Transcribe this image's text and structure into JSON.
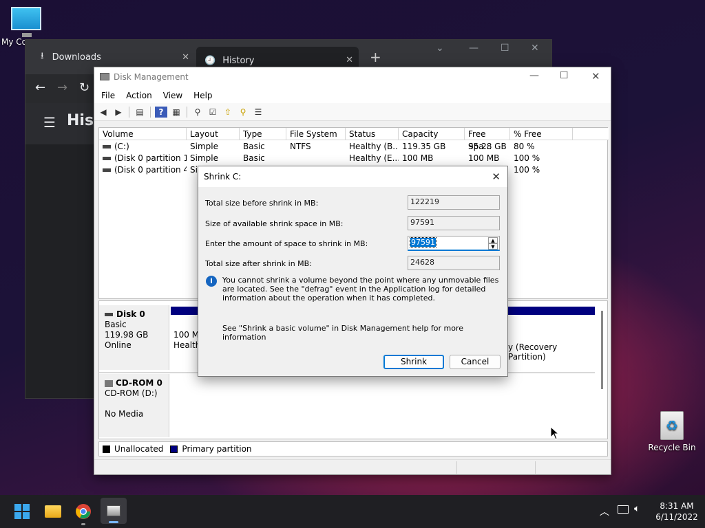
{
  "desktop": {
    "icons": [
      {
        "label": "My Co"
      },
      {
        "label": "Recycle Bin"
      }
    ]
  },
  "browser": {
    "tabs": [
      {
        "label": "Downloads"
      },
      {
        "label": "History"
      }
    ],
    "new_tab": "+",
    "page_heading": "Hist"
  },
  "disk_management": {
    "title": "Disk Management",
    "menu": [
      "File",
      "Action",
      "View",
      "Help"
    ],
    "columns": [
      "Volume",
      "Layout",
      "Type",
      "File System",
      "Status",
      "Capacity",
      "Free Spa...",
      "% Free"
    ],
    "volumes": [
      {
        "volume": "(C:)",
        "layout": "Simple",
        "type": "Basic",
        "fs": "NTFS",
        "status": "Healthy (B...",
        "capacity": "119.35 GB",
        "free": "95.28 GB",
        "pct": "80 %"
      },
      {
        "volume": "(Disk 0 partition 1)",
        "layout": "Simple",
        "type": "Basic",
        "fs": "",
        "status": "Healthy (E...",
        "capacity": "100 MB",
        "free": "100 MB",
        "pct": "100 %"
      },
      {
        "volume": "(Disk 0 partition 4)",
        "layout": "Si",
        "type": "",
        "fs": "",
        "status": "",
        "capacity": "",
        "free": "",
        "pct": "100 %"
      }
    ],
    "disks": [
      {
        "name": "Disk 0",
        "type": "Basic",
        "size": "119.98 GB",
        "state": "Online",
        "part1_size": "100 M",
        "part1_status": "Health",
        "part_last": "y (Recovery Partition)"
      },
      {
        "name": "CD-ROM 0",
        "type": "CD-ROM (D:)",
        "size": "",
        "state": "No Media"
      }
    ],
    "legend": [
      {
        "label": "Unallocated",
        "color": "#000000"
      },
      {
        "label": "Primary partition",
        "color": "#00007f"
      }
    ]
  },
  "shrink_dialog": {
    "title": "Shrink C:",
    "fields": {
      "total_before_label": "Total size before shrink in MB:",
      "total_before_value": "122219",
      "available_label": "Size of available shrink space in MB:",
      "available_value": "97591",
      "amount_label": "Enter the amount of space to shrink in MB:",
      "amount_value": "97591",
      "total_after_label": "Total size after shrink in MB:",
      "total_after_value": "24628"
    },
    "info": "You cannot shrink a volume beyond the point where any unmovable files are located. See the \"defrag\" event in the Application log for detailed information about the operation when it has completed.",
    "help": "See \"Shrink a basic volume\" in Disk Management help for more information",
    "shrink_label": "Shrink",
    "cancel_label": "Cancel"
  },
  "taskbar": {
    "time": "8:31 AM",
    "date": "6/11/2022"
  },
  "colors": {
    "primary_partition": "#00007f",
    "accent": "#0078d4"
  }
}
